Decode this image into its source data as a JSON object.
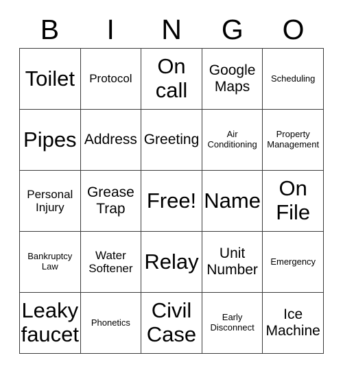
{
  "card": {
    "header_letters": [
      "B",
      "I",
      "N",
      "G",
      "O"
    ],
    "columns": 5,
    "rows": 5,
    "colors": {
      "background": "#ffffff",
      "border": "#3a3a3a",
      "text": "#000000"
    },
    "cells": [
      {
        "label": "Toilet",
        "size": "xl",
        "free": false
      },
      {
        "label": "Protocol",
        "size": "sm",
        "free": false
      },
      {
        "label": "On call",
        "size": "xl",
        "free": false
      },
      {
        "label": "Google Maps",
        "size": "md",
        "free": false
      },
      {
        "label": "Scheduling",
        "size": "xs",
        "free": false
      },
      {
        "label": "Pipes",
        "size": "xl",
        "free": false
      },
      {
        "label": "Address",
        "size": "md",
        "free": false
      },
      {
        "label": "Greeting",
        "size": "md",
        "free": false
      },
      {
        "label": "Air Conditioning",
        "size": "xs",
        "free": false
      },
      {
        "label": "Property Management",
        "size": "xs",
        "free": false
      },
      {
        "label": "Personal Injury",
        "size": "sm",
        "free": false
      },
      {
        "label": "Grease Trap",
        "size": "md",
        "free": false
      },
      {
        "label": "Free!",
        "size": "xl",
        "free": true
      },
      {
        "label": "Name",
        "size": "xl",
        "free": false
      },
      {
        "label": "On File",
        "size": "xl",
        "free": false
      },
      {
        "label": "Bankruptcy Law",
        "size": "xs",
        "free": false
      },
      {
        "label": "Water Softener",
        "size": "sm",
        "free": false
      },
      {
        "label": "Relay",
        "size": "xl",
        "free": false
      },
      {
        "label": "Unit Number",
        "size": "md",
        "free": false
      },
      {
        "label": "Emergency",
        "size": "xs",
        "free": false
      },
      {
        "label": "Leaky faucet",
        "size": "xl",
        "free": false
      },
      {
        "label": "Phonetics",
        "size": "xs",
        "free": false
      },
      {
        "label": "Civil Case",
        "size": "xl",
        "free": false
      },
      {
        "label": "Early Disconnect",
        "size": "xs",
        "free": false
      },
      {
        "label": "Ice Machine",
        "size": "md",
        "free": false
      }
    ]
  }
}
